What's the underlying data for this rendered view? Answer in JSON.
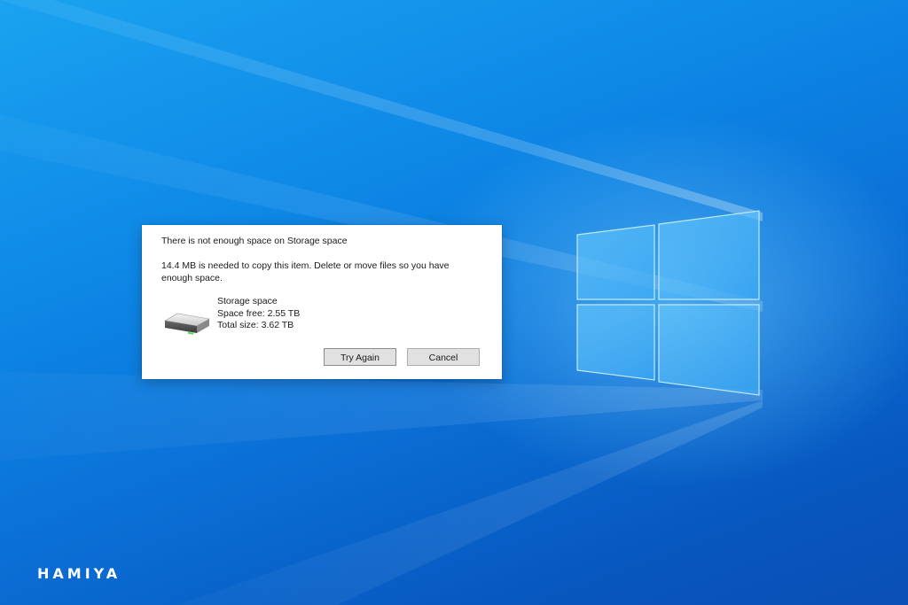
{
  "dialog": {
    "title": "There is not enough space on Storage space",
    "message": "14.4 MB is needed to copy this item. Delete or move files so you have enough space.",
    "drive": {
      "icon": "hard-drive-icon",
      "name": "Storage space",
      "space_free": "Space free: 2.55 TB",
      "total_size": "Total size: 3.62 TB"
    },
    "buttons": {
      "try_again": "Try Again",
      "cancel": "Cancel"
    }
  },
  "desktop": {
    "logo": "windows-logo-icon",
    "watermark": "HAMIYA"
  },
  "colors": {
    "desktop_blue": "#0a78d8",
    "dialog_bg": "#ffffff",
    "button_bg": "#e1e1e1"
  }
}
